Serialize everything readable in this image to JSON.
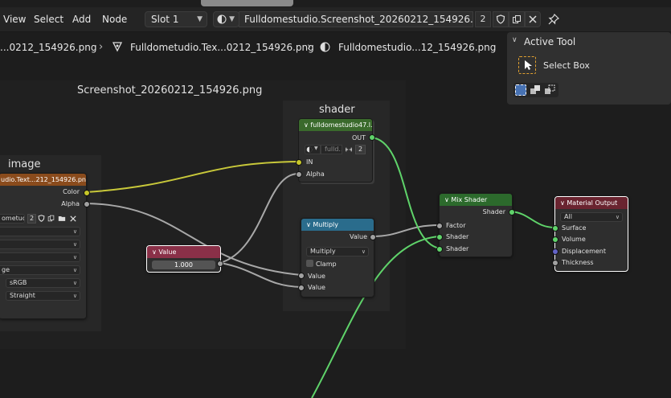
{
  "menu": {
    "view": "View",
    "select": "Select",
    "add": "Add",
    "node": "Node"
  },
  "slot": {
    "label": "Slot 1"
  },
  "image_selector": {
    "name": "Fulldomestudio.Screenshot_20260212_154926.png",
    "users": "2"
  },
  "breadcrumb": {
    "item1": "...0212_154926.png",
    "item2": "Fulldometudio.Tex...0212_154926.png",
    "item3": "Fulldomestudio...12_154926.png"
  },
  "active_tool": {
    "title": "Active Tool",
    "tool_name": "Select Box"
  },
  "frames": {
    "screenshot": "Screenshot_20260212_154926.png",
    "image": "image",
    "shader": "shader"
  },
  "image_node": {
    "title": "udio.Text...212_154926.png",
    "out_color": "Color",
    "out_alpha": "Alpha",
    "img_name": "ometud...",
    "users": "2",
    "colorspace": "sRGB",
    "alpha_mode": "Straight",
    "partial": "ge"
  },
  "group_node": {
    "title": "fulldomestudio47.l...",
    "out": "OUT",
    "field": "fulld...",
    "users": "2",
    "in": "IN",
    "alpha": "Alpha"
  },
  "value_node": {
    "title": "Value",
    "value": "1.000"
  },
  "multiply_node": {
    "title": "Multiply",
    "out": "Value",
    "op": "Multiply",
    "clamp": "Clamp",
    "in1": "Value",
    "in2": "Value"
  },
  "mix_node": {
    "title": "Mix Shader",
    "out": "Shader",
    "factor": "Factor",
    "shader1": "Shader",
    "shader2": "Shader"
  },
  "output_node": {
    "title": "Material Output",
    "target": "All",
    "surface": "Surface",
    "volume": "Volume",
    "displacement": "Displacement",
    "thickness": "Thickness"
  },
  "colors": {
    "texture_header": "#8a4b1c",
    "group_header": "#3a6a2c",
    "value_header": "#8a3048",
    "math_header": "#2a6c8c",
    "shader_header": "#2c6a2c",
    "output_header": "#6a2430",
    "link_color": "#c8c83a",
    "link_shader": "#5fd36a",
    "link_gray": "#a8a8a8"
  },
  "icons": [
    "image-sphere-icon",
    "shield-icon",
    "duplicate-icon",
    "close-icon",
    "pin-icon",
    "shader-tree-icon",
    "material-sphere-icon",
    "cursor-select-icon"
  ]
}
